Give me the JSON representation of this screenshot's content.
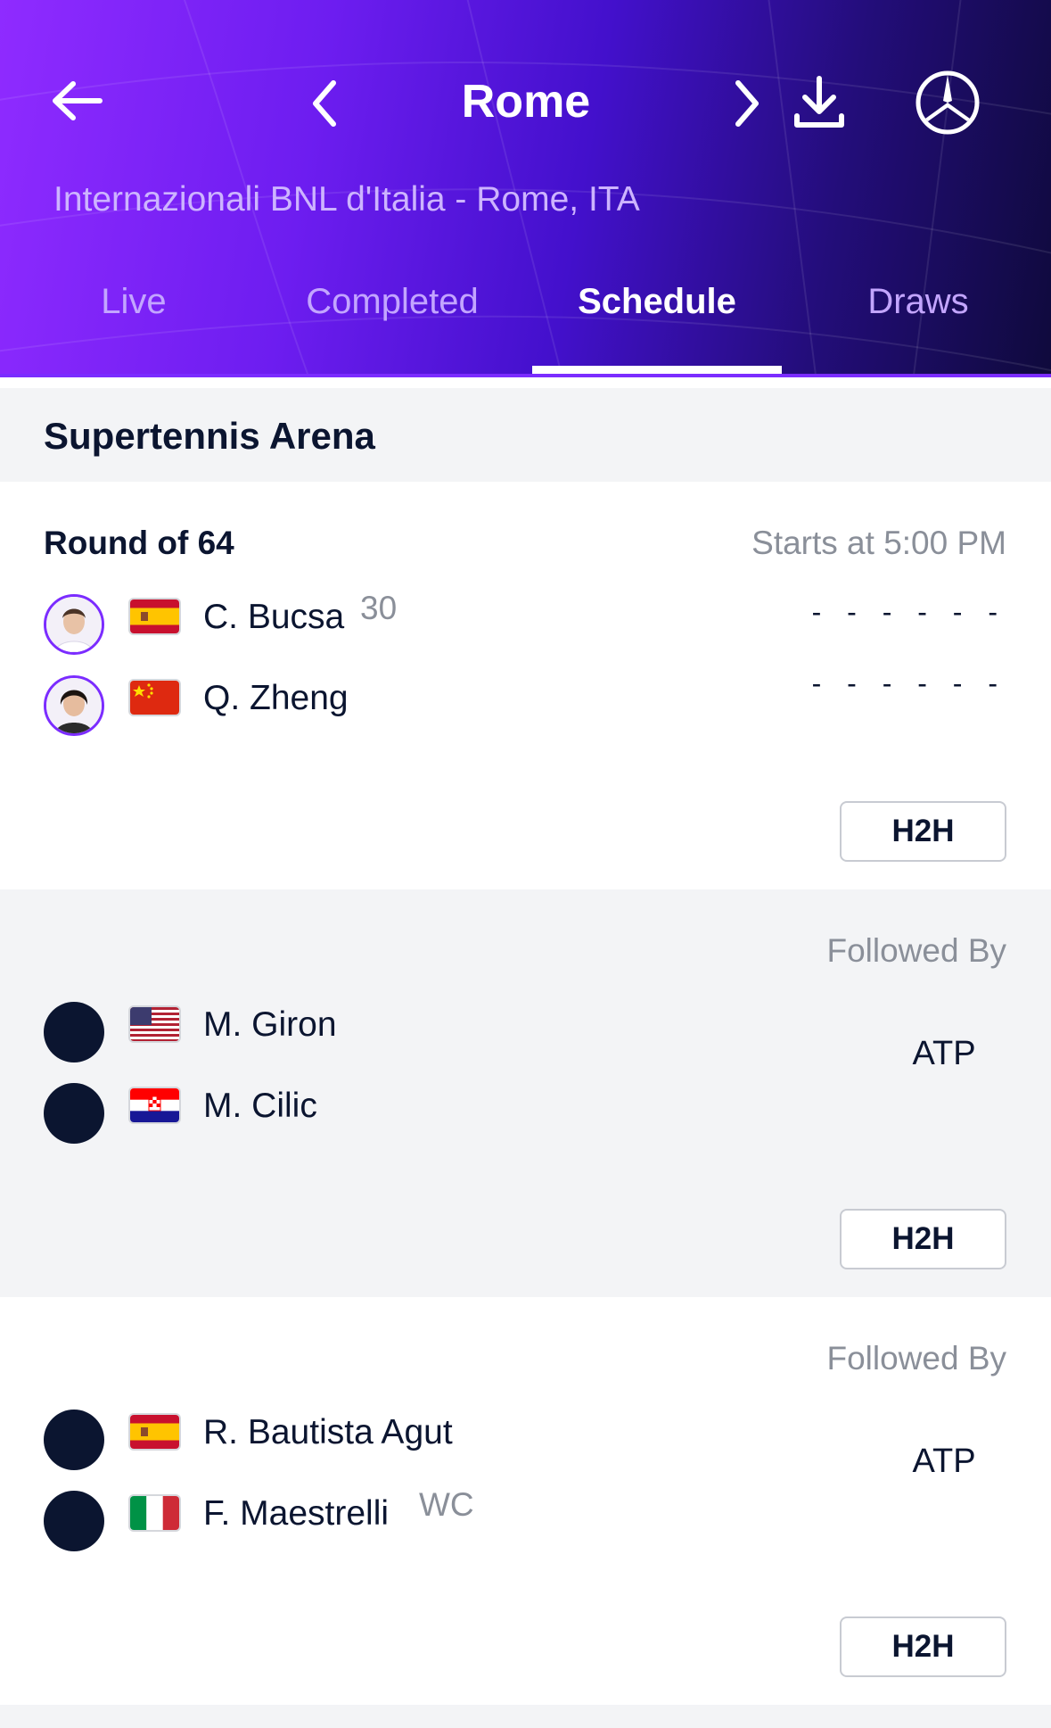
{
  "header": {
    "title": "Rome",
    "subtitle": "Internazionali BNL d'Italia - Rome, ITA",
    "icons": [
      "back-arrow-icon",
      "chevron-left-icon",
      "chevron-right-icon",
      "download-icon",
      "mercedes-star-icon"
    ],
    "gradient_colors": [
      "#8f2bff",
      "#4310cc",
      "#0f0a3c"
    ]
  },
  "tabs": [
    {
      "label": "Live",
      "active": false
    },
    {
      "label": "Completed",
      "active": false
    },
    {
      "label": "Schedule",
      "active": true
    },
    {
      "label": "Draws",
      "active": false
    }
  ],
  "court": {
    "name": "Supertennis Arena"
  },
  "matches": [
    {
      "round": "Round of 64",
      "status": "Starts at 5:00 PM",
      "players": [
        {
          "name": "C. Bucsa",
          "seed": "30",
          "flag": "ESP",
          "score": "- - - - - -"
        },
        {
          "name": "Q. Zheng",
          "seed": "",
          "flag": "CHN",
          "score": "- - - - - -"
        }
      ],
      "h2h_label": "H2H"
    },
    {
      "status": "Followed By",
      "tour": "ATP",
      "players": [
        {
          "name": "M. Giron",
          "seed": "",
          "flag": "USA"
        },
        {
          "name": "M. Cilic",
          "seed": "",
          "flag": "CRO"
        }
      ],
      "h2h_label": "H2H"
    },
    {
      "status": "Followed By",
      "tour": "ATP",
      "players": [
        {
          "name": "R. Bautista Agut",
          "seed": "",
          "flag": "ESP"
        },
        {
          "name": "F. Maestrelli",
          "seed": "WC",
          "flag": "ITA"
        }
      ],
      "h2h_label": "H2H"
    }
  ],
  "colors": {
    "accent": "#7b2cff",
    "text_primary": "#0b1530",
    "text_secondary": "#8a8f99",
    "section_grey": "#f3f4f6"
  }
}
